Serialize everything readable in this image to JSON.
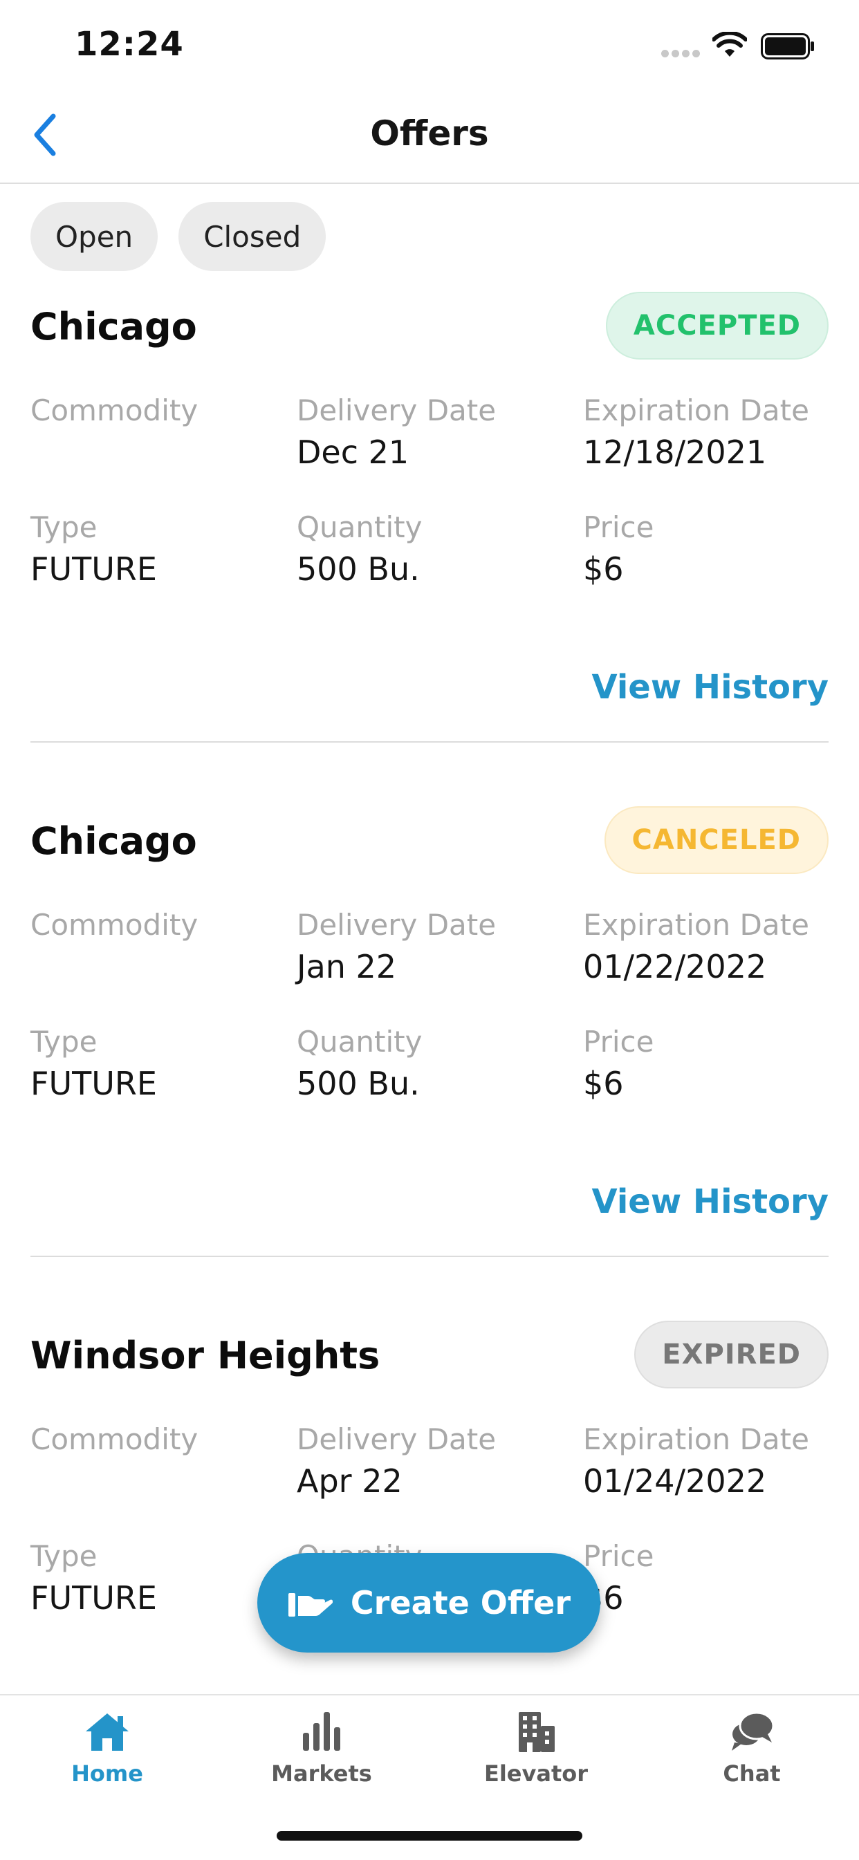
{
  "status_bar": {
    "time": "12:24"
  },
  "header": {
    "title": "Offers",
    "back_icon": "chevron-left-icon"
  },
  "filters": {
    "open_label": "Open",
    "closed_label": "Closed"
  },
  "labels": {
    "commodity": "Commodity",
    "delivery_date": "Delivery Date",
    "expiration_date": "Expiration Date",
    "type": "Type",
    "quantity": "Quantity",
    "price": "Price",
    "view_history": "View History"
  },
  "offers": [
    {
      "location": "Chicago",
      "status": "ACCEPTED",
      "status_bg": "#dff5ea",
      "status_color": "#22c16c",
      "commodity": "",
      "delivery_date": "Dec 21",
      "expiration_date": "12/18/2021",
      "type": "FUTURE",
      "quantity": "500 Bu.",
      "price": "$6"
    },
    {
      "location": "Chicago",
      "status": "CANCELED",
      "status_bg": "#fff4dc",
      "status_color": "#f5b732",
      "commodity": "",
      "delivery_date": "Jan 22",
      "expiration_date": "01/22/2022",
      "type": "FUTURE",
      "quantity": "500 Bu.",
      "price": "$6"
    },
    {
      "location": "Windsor Heights",
      "status": "EXPIRED",
      "status_bg": "#ebebeb",
      "status_color": "#777777",
      "commodity": "",
      "delivery_date": "Apr 22",
      "expiration_date": "01/24/2022",
      "type": "FUTURE",
      "quantity": "",
      "price": "$6"
    }
  ],
  "fab": {
    "label": "Create Offer",
    "icon": "hand-offer-icon"
  },
  "tabs": [
    {
      "label": "Home",
      "icon": "home-icon",
      "active": true
    },
    {
      "label": "Markets",
      "icon": "bar-chart-icon",
      "active": false
    },
    {
      "label": "Elevator",
      "icon": "building-icon",
      "active": false
    },
    {
      "label": "Chat",
      "icon": "chat-bubbles-icon",
      "active": false
    }
  ],
  "colors": {
    "accent": "#2495cb",
    "back_arrow": "#1a7fe0",
    "tab_active": "#2494c9",
    "tab_inactive": "#5b5b5b"
  }
}
